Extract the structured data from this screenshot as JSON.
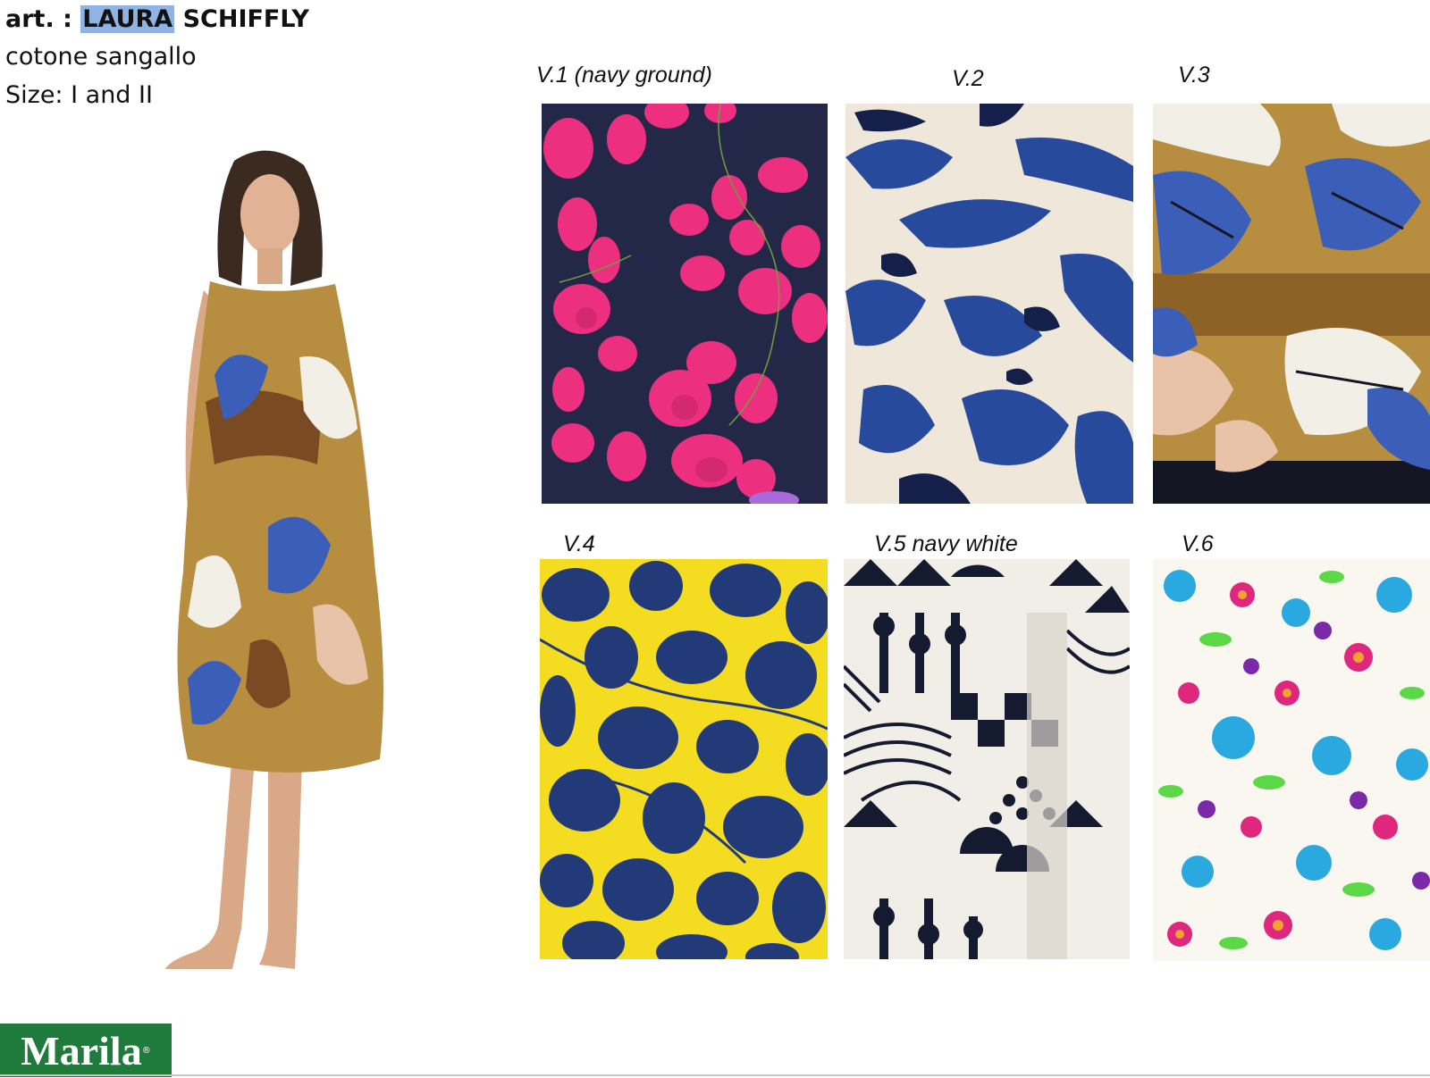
{
  "header": {
    "prefix": "art. : ",
    "name_highlight": "LAURA",
    "name_rest": " SCHIFFLY",
    "material": "cotone sangallo",
    "size": "Size: I and II"
  },
  "variants": [
    {
      "label": "V.1 (navy ground)",
      "colors": {
        "ground": "#232848",
        "accent": "#ec2f7e",
        "accent2": "#c52668"
      }
    },
    {
      "label": "V.2",
      "colors": {
        "ground": "#efe7d9",
        "accent": "#274a9c",
        "accent2": "#15204a"
      }
    },
    {
      "label": "V.3",
      "colors": {
        "ground": "#b78d3f",
        "accent": "#3b5fb8",
        "accent2": "#f2efe6"
      }
    },
    {
      "label": "V.4",
      "colors": {
        "ground": "#f4dc21",
        "accent": "#233a78"
      }
    },
    {
      "label": "V.5 navy white",
      "colors": {
        "ground": "#f1eee8",
        "accent": "#141a30"
      }
    },
    {
      "label": "V.6",
      "colors": {
        "ground": "#faf7f0",
        "accent": "#2aa8e0",
        "accent2": "#e0277e",
        "accent3": "#5ad846"
      }
    }
  ],
  "logo": {
    "text": "Marila",
    "mark": "®",
    "color": "#1e7b3c"
  }
}
